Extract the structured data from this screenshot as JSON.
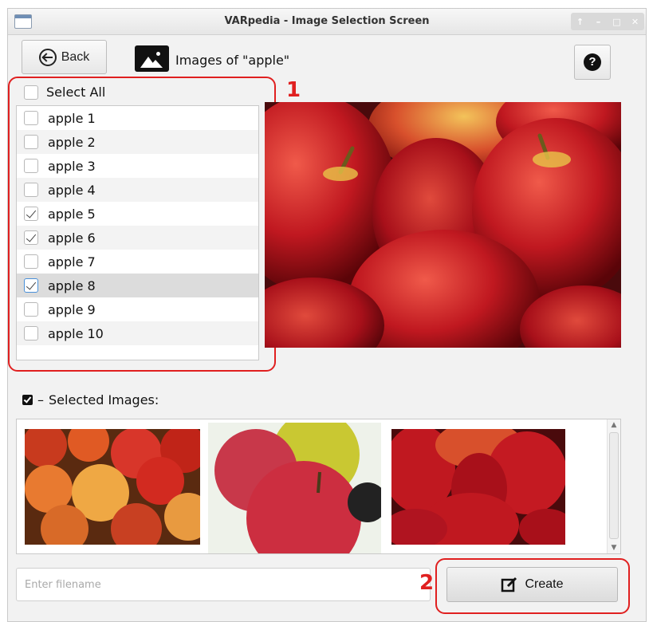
{
  "window": {
    "title": "VARpedia - Image Selection Screen",
    "controls": [
      "↑",
      "–",
      "□",
      "✕"
    ]
  },
  "header": {
    "back_label": "Back",
    "page_title": "Images of \"apple\"",
    "help_symbol": "?"
  },
  "callouts": {
    "one": "1",
    "two": "2"
  },
  "image_list": {
    "select_all_label": "Select All",
    "items": [
      {
        "label": "apple 1",
        "checked": false
      },
      {
        "label": "apple 2",
        "checked": false
      },
      {
        "label": "apple 3",
        "checked": false
      },
      {
        "label": "apple 4",
        "checked": false
      },
      {
        "label": "apple 5",
        "checked": true
      },
      {
        "label": "apple 6",
        "checked": true
      },
      {
        "label": "apple 7",
        "checked": false
      },
      {
        "label": "apple 8",
        "checked": true,
        "selected": true
      },
      {
        "label": "apple 9",
        "checked": false
      },
      {
        "label": "apple 10",
        "checked": false
      }
    ]
  },
  "selected_images": {
    "label": "Selected Images:"
  },
  "footer": {
    "filename_placeholder": "Enter filename",
    "create_label": "Create"
  },
  "colors": {
    "annotation_red": "#e02020",
    "apple_red": "#b5121b",
    "selected_row": "#dcdcdc"
  }
}
